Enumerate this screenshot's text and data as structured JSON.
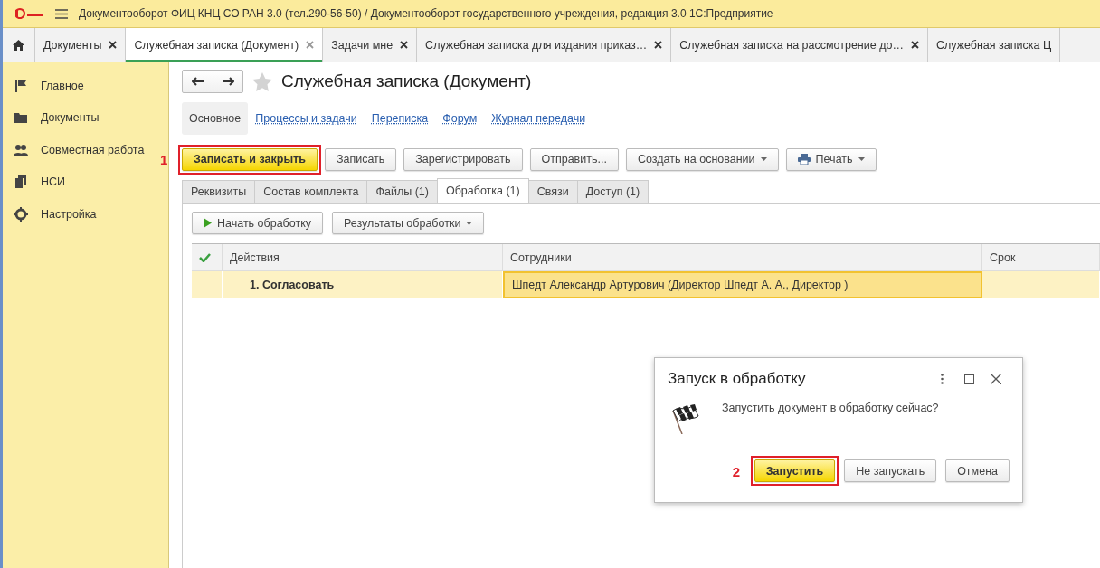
{
  "window": {
    "title": "Документооборот ФИЦ КНЦ СО РАН 3.0 (тел.290-56-50) / Документооборот государственного учреждения, редакция 3.0 1С:Предприятие"
  },
  "open_tabs": [
    {
      "label": "Документы",
      "selected": false,
      "closable": true
    },
    {
      "label": "Служебная записка (Документ)",
      "selected": true,
      "closable": true
    },
    {
      "label": "Задачи мне",
      "selected": false,
      "closable": true
    },
    {
      "label": "Служебная записка для издания приказ…",
      "selected": false,
      "closable": true
    },
    {
      "label": "Служебная записка на рассмотрение до…",
      "selected": false,
      "closable": true
    },
    {
      "label": "Служебная записка Ц",
      "selected": false,
      "closable": false
    }
  ],
  "sidebar": {
    "items": [
      {
        "label": "Главное",
        "kind": "flag"
      },
      {
        "label": "Документы",
        "kind": "folder"
      },
      {
        "label": "Совместная работа",
        "kind": "people"
      },
      {
        "label": "НСИ",
        "kind": "books"
      },
      {
        "label": "Настройка",
        "kind": "gear"
      }
    ]
  },
  "form": {
    "title": "Служебная записка (Документ)",
    "sections": [
      {
        "label": "Основное",
        "selected": true
      },
      {
        "label": "Процессы и задачи",
        "selected": false
      },
      {
        "label": "Переписка",
        "selected": false
      },
      {
        "label": "Форум",
        "selected": false
      },
      {
        "label": "Журнал передачи",
        "selected": false
      }
    ],
    "commands": [
      {
        "label": "Записать и закрыть",
        "kind": "default",
        "callout": "1"
      },
      {
        "label": "Записать",
        "kind": "plain"
      },
      {
        "label": "Зарегистрировать",
        "kind": "plain"
      },
      {
        "label": "Отправить...",
        "kind": "plain"
      },
      {
        "label": "Создать на основании",
        "kind": "dropdown"
      },
      {
        "label": "Печать",
        "kind": "print"
      }
    ],
    "tabs": [
      {
        "label": "Реквизиты",
        "selected": false
      },
      {
        "label": "Состав комплекта",
        "selected": false
      },
      {
        "label": "Файлы (1)",
        "selected": false
      },
      {
        "label": "Обработка (1)",
        "selected": true
      },
      {
        "label": "Связи",
        "selected": false
      },
      {
        "label": "Доступ (1)",
        "selected": false
      }
    ],
    "process_buttons": [
      {
        "label": "Начать обработку",
        "kind": "start"
      },
      {
        "label": "Результаты обработки",
        "kind": "dropdown"
      }
    ],
    "table": {
      "columns": [
        "Действия",
        "Сотрудники",
        "Срок"
      ],
      "rows": [
        {
          "cells": [
            "1. Согласовать",
            "Шпедт Александр Артурович (Директор Шпедт А. А., Директор )",
            ""
          ],
          "selected": true
        }
      ]
    }
  },
  "dialog": {
    "title": "Запуск в обработку",
    "message": "Запустить документ в обработку сейчас?",
    "buttons": [
      {
        "label": "Запустить",
        "kind": "default",
        "callout": "2"
      },
      {
        "label": "Не запускать",
        "kind": "plain"
      },
      {
        "label": "Отмена",
        "kind": "plain"
      }
    ]
  }
}
